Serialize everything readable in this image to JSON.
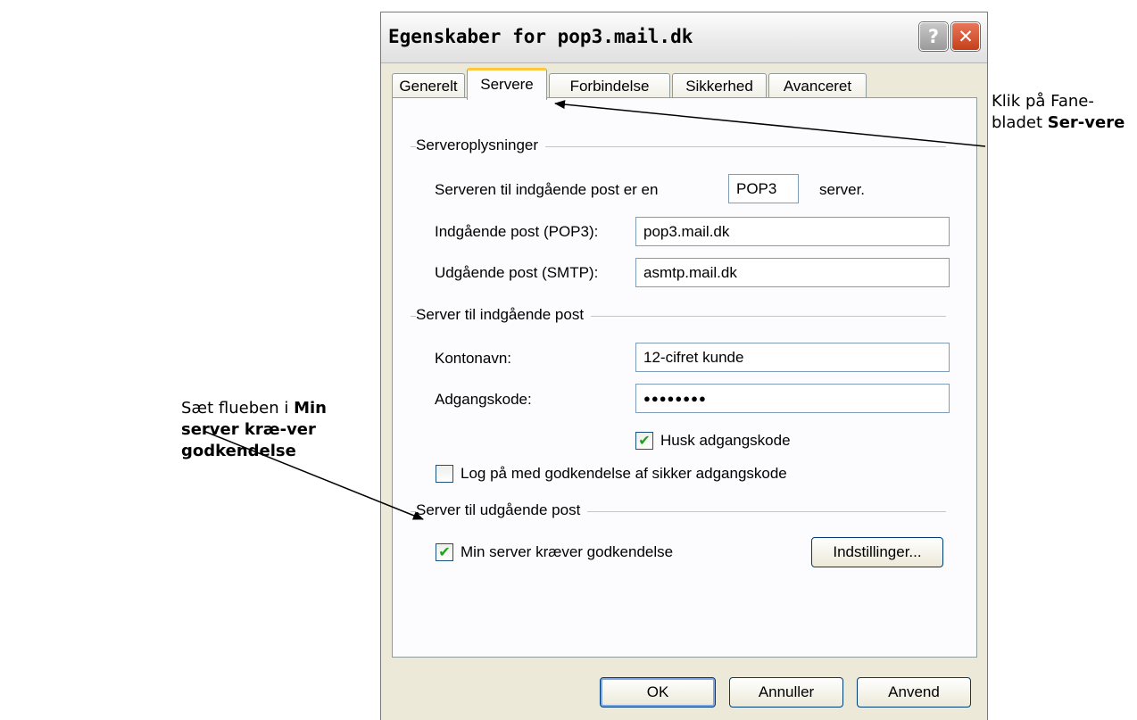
{
  "dialog": {
    "title": "Egenskaber for pop3.mail.dk",
    "help_label": "?",
    "close_label": "✕"
  },
  "tabs": [
    {
      "label": "Generelt"
    },
    {
      "label": "Servere"
    },
    {
      "label": "Forbindelse"
    },
    {
      "label": "Sikkerhed"
    },
    {
      "label": "Avanceret"
    }
  ],
  "server_info": {
    "title": "Serveroplysninger",
    "type_prefix": "Serveren til indgående post er en",
    "type_value": "POP3",
    "type_suffix": "server.",
    "incoming_label": "Indgående post (POP3):",
    "incoming_value": "pop3.mail.dk",
    "outgoing_label": "Udgående post (SMTP):",
    "outgoing_value": "asmtp.mail.dk"
  },
  "incoming_server": {
    "title": "Server til indgående post",
    "account_label": "Kontonavn:",
    "account_value": "12-cifret kunde",
    "password_label": "Adgangskode:",
    "password_value": "●●●●●●●●",
    "remember_label": "Husk adgangskode",
    "remember_checked": true,
    "spa_label": "Log på med godkendelse af sikker adgangskode",
    "spa_checked": false
  },
  "outgoing_server": {
    "title": "Server til udgående post",
    "auth_label": "Min server kræver godkendelse",
    "auth_checked": true,
    "settings_label": "Indstillinger..."
  },
  "buttons": {
    "ok": "OK",
    "cancel": "Annuller",
    "apply": "Anvend"
  },
  "annotations": {
    "left_prefix": "Sæt flueben i",
    "left_bold": "Min server kræ-ver godkendelse",
    "right_prefix": "Klik på Fane-bladet",
    "right_bold": "Ser-vere"
  }
}
